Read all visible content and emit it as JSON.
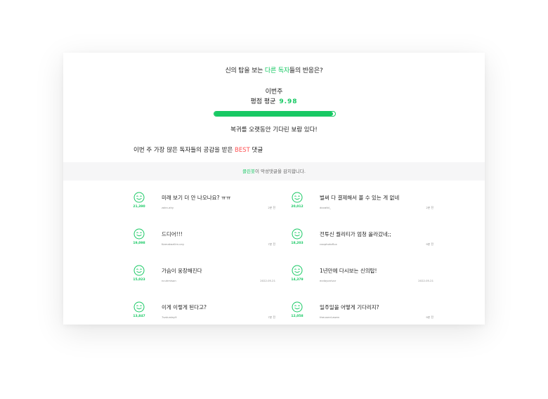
{
  "header": {
    "question_prefix": "신의 탑을 보는 ",
    "question_highlight": "다른 독자",
    "question_suffix": "들의 반응은?",
    "week_label": "이번주",
    "avg_label": "평점 평균",
    "avg_score": "9.98",
    "progress_fraction": 0.98,
    "review_text": "복귀를 오랫동안 기다린 보람 있다!"
  },
  "best": {
    "heading_prefix": "이번 주 가장 많은 독자들의 공감을 받은 ",
    "heading_highlight": "BEST",
    "heading_suffix": " 댓글"
  },
  "notice": {
    "highlight": "클린봇",
    "text": "이 악성댓글을 감지합니다."
  },
  "comments": [
    {
      "likes": "21,390",
      "text": "미래 보기 더 안 나오나요? ㅠㅠ",
      "user": "zakn.ahy",
      "date": "2분 전"
    },
    {
      "likes": "20,012",
      "text": "벌써 다 결제해서 볼 수 있는 게 없네",
      "user": "dovatkl_",
      "date": "2분 전"
    },
    {
      "likes": "19,098",
      "text": "드디어!!!",
      "user": "Kamakazilim.ony",
      "date": "7분 전"
    },
    {
      "likes": "18,203",
      "text": "전투신 퀄리티가 엄청 올라갔네;;",
      "user": "coophotoflux",
      "date": "9분 전"
    },
    {
      "likes": "15,023",
      "text": "가슴이 웅장해진다",
      "user": "ncuhmison",
      "date": "2022.05.21"
    },
    {
      "likes": "14,379",
      "text": "1년만에 다시보는 신의탑!",
      "user": "ecdoyonivor",
      "date": "2022.05.21"
    },
    {
      "likes": "13,847",
      "text": "이게 이렇게 된다고?",
      "user": "7saturday9",
      "date": "7분 전"
    },
    {
      "likes": "12,058",
      "text": "일주일을 어떻게 기다리지?",
      "user": "theuserd.awen",
      "date": "9분 전"
    }
  ]
}
